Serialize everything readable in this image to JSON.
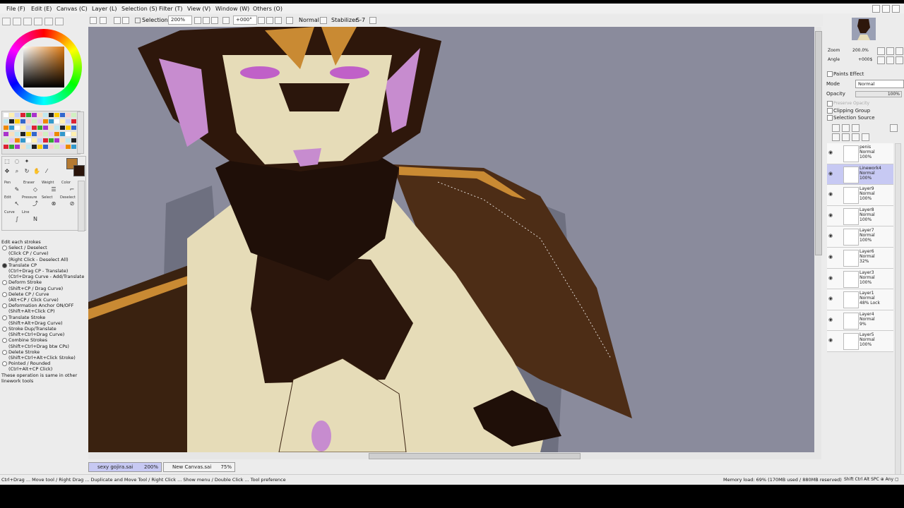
{
  "menu": [
    {
      "label": "File (F)"
    },
    {
      "label": "Edit (E)"
    },
    {
      "label": "Canvas (C)"
    },
    {
      "label": "Layer (L)"
    },
    {
      "label": "Selection (S)"
    },
    {
      "label": "Filter (T)"
    },
    {
      "label": "View (V)"
    },
    {
      "label": "Window (W)"
    },
    {
      "label": "Others (O)"
    }
  ],
  "toolbar": {
    "selection_label": "Selection",
    "zoom": "200%",
    "angle": "+000°",
    "blend": "Normal",
    "stabilizer_label": "Stabilizer",
    "stabilizer_value": "S-7"
  },
  "tools": {
    "tabs": [
      "Pen",
      "Eraser",
      "Weight",
      "Color"
    ],
    "tabs2": [
      "Edit",
      "Pressure",
      "Select",
      "Deselect"
    ],
    "tabs3": [
      "Curve",
      "Line"
    ]
  },
  "tool_options": {
    "header": "Edit each strokes",
    "items": [
      {
        "label": "Select / Deselect",
        "sub": [
          "(Click CP / Curve)",
          "(Right Click - Deselect All)"
        ],
        "selected": false
      },
      {
        "label": "Translate CP",
        "sub": [
          "(Ctrl+Drag CP - Translate)",
          "(Ctrl+Drag Curve - Add/Translate"
        ],
        "selected": true
      },
      {
        "label": "Deform Stroke",
        "sub": [
          "(Shift+CP / Drag Curve)"
        ],
        "selected": false
      },
      {
        "label": "Delete CP / Curve",
        "sub": [
          "(Alt+CP / Click Curve)"
        ],
        "selected": false
      },
      {
        "label": "Deformation Anchor ON/OFF",
        "sub": [
          "(Shift+Alt+Click CP)"
        ],
        "selected": false
      },
      {
        "label": "Translate Stroke",
        "sub": [
          "(Shift+Alt+Drag Curve)"
        ],
        "selected": false
      },
      {
        "label": "Stroke Dup/Translate",
        "sub": [
          "(Shift+Ctrl+Drag Curve)"
        ],
        "selected": false
      },
      {
        "label": "Combine Strokes",
        "sub": [
          "(Shift+Ctrl+Drag btw CPs)"
        ],
        "selected": false
      },
      {
        "label": "Delete Stroke",
        "sub": [
          "(Shift+Ctrl+Alt+Click Stroke)"
        ],
        "selected": false
      },
      {
        "label": "Pointed / Rounded",
        "sub": [
          "(Ctrl+Alt+CP Click)"
        ],
        "selected": false
      }
    ],
    "footer": "These operation is same in other linework tools"
  },
  "navigator": {
    "zoom_label": "Zoom",
    "zoom_value": "200.0%",
    "angle_label": "Angle",
    "angle_value": "+000$"
  },
  "layer_panel": {
    "paints_effect": "Paints Effect",
    "mode_label": "Mode",
    "mode_value": "Normal",
    "opacity_label": "Opacity",
    "opacity_value": "100%",
    "preserve_opacity": "Preserve Opacity",
    "clipping_group": "Clipping Group",
    "selection_source": "Selection Source"
  },
  "layers": [
    {
      "name": "penis",
      "mode": "Normal",
      "opacity": "100%",
      "selected": false,
      "linework": true,
      "extra": ""
    },
    {
      "name": "Linework4",
      "mode": "Normal",
      "opacity": "100%",
      "selected": true,
      "linework": true,
      "extra": ""
    },
    {
      "name": "Layer9",
      "mode": "Normal",
      "opacity": "100%",
      "selected": false,
      "linework": false,
      "extra": ""
    },
    {
      "name": "Layer8",
      "mode": "Normal",
      "opacity": "100%",
      "selected": false,
      "linework": false,
      "extra": ""
    },
    {
      "name": "Layer7",
      "mode": "Normal",
      "opacity": "100%",
      "selected": false,
      "linework": false,
      "extra": ""
    },
    {
      "name": "Layer6",
      "mode": "Normal",
      "opacity": "32%",
      "selected": false,
      "linework": false,
      "extra": ""
    },
    {
      "name": "Layer3",
      "mode": "Normal",
      "opacity": "100%",
      "selected": false,
      "linework": false,
      "extra": ""
    },
    {
      "name": "Layer1",
      "mode": "Normal",
      "opacity": "48%",
      "selected": false,
      "linework": false,
      "extra": "Lock"
    },
    {
      "name": "Layer4",
      "mode": "Normal",
      "opacity": "9%",
      "selected": false,
      "linework": false,
      "extra": ""
    },
    {
      "name": "Layer5",
      "mode": "Normal",
      "opacity": "100%",
      "selected": false,
      "linework": false,
      "extra": ""
    }
  ],
  "documents": [
    {
      "name": "sexy gojira.sai",
      "zoom": "200%",
      "active": true
    },
    {
      "name": "New Canvas.sai",
      "zoom": "75%",
      "active": false
    }
  ],
  "status": {
    "hint": "Ctrl+Drag ... Move tool / Right Drag ... Duplicate and Move Tool / Right Click ... Show menu / Double Click ... Tool preference",
    "memory": "Memory load: 69% (170MB used / 880MB reserved)",
    "keys": "Shift Ctrl Alt SPC ⊕ Any ▢"
  },
  "colors": {
    "canvas_bg": "#8a8b9c",
    "fur_dark": "#2b160c",
    "fur_brown": "#5c3418",
    "cream": "#e6dcb8",
    "accent_orange": "#c98a33",
    "pink": "#c78ccf"
  }
}
